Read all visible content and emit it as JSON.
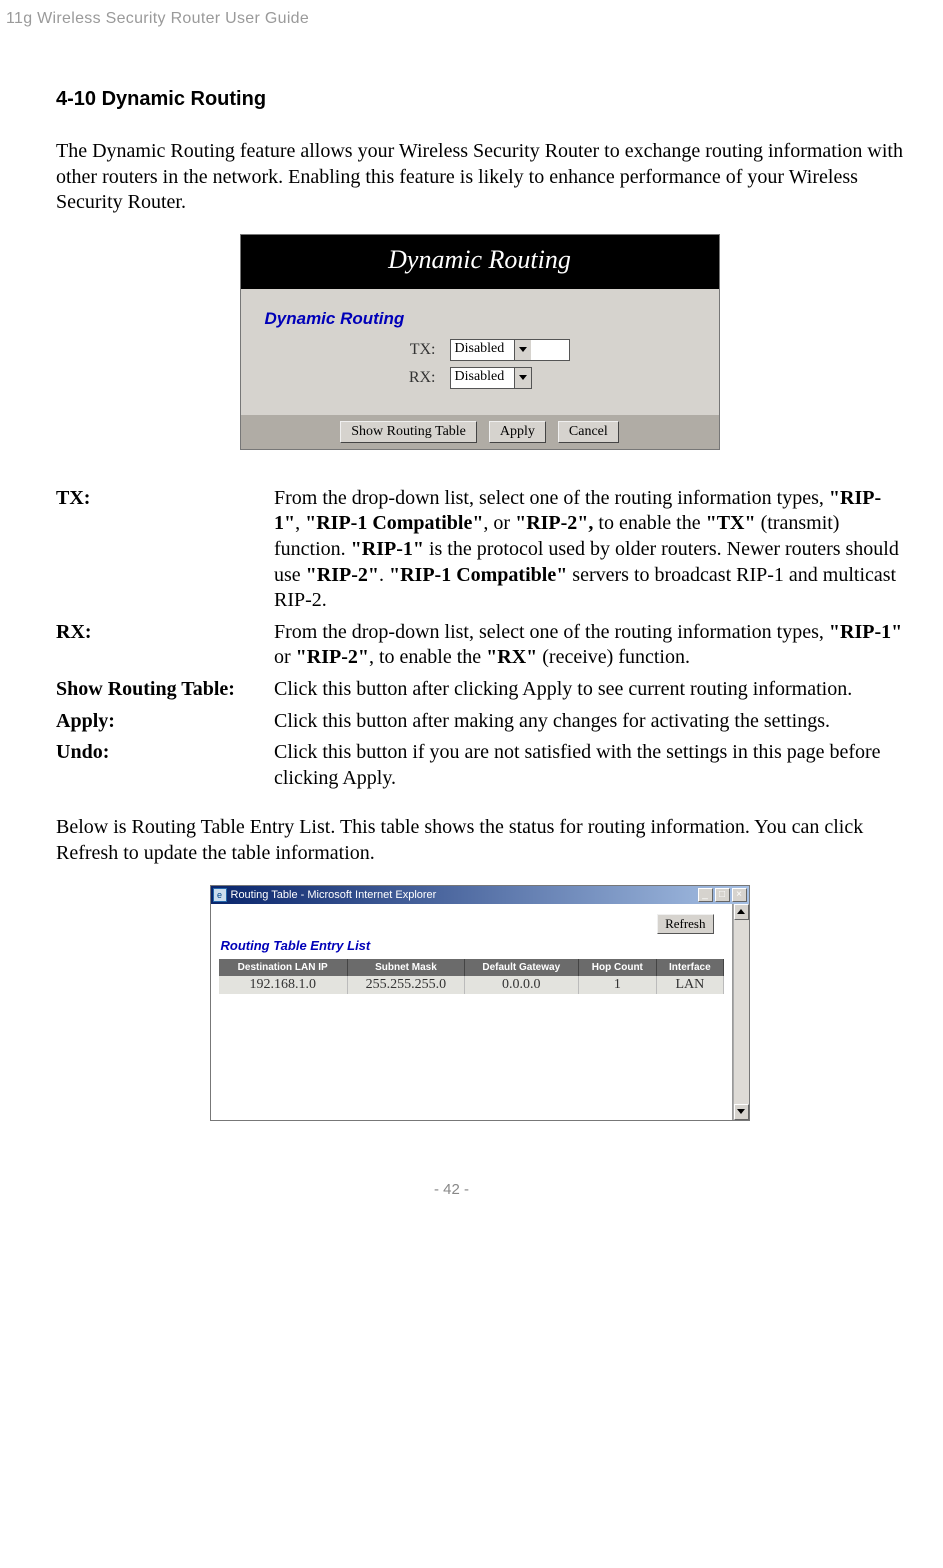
{
  "header": "11g Wireless Security Router User Guide",
  "section_title": "4-10 Dynamic Routing",
  "intro": "The Dynamic Routing feature allows your Wireless Security Router to exchange routing information with other routers in the network. Enabling this feature is likely to enhance performance of your Wireless Security Router.",
  "fig1": {
    "title": "Dynamic Routing",
    "subtitle": "Dynamic Routing",
    "tx_label": "TX:",
    "rx_label": "RX:",
    "tx_value": "Disabled",
    "rx_value": "Disabled",
    "btn_show": "Show Routing Table",
    "btn_apply": "Apply",
    "btn_cancel": "Cancel"
  },
  "defs": {
    "tx": {
      "term": "TX:",
      "p1": "From the drop-down list, select one of the routing information types, ",
      "b1": "\"RIP-1\"",
      "p2": ", ",
      "b2": "\"RIP-1 Compatible\"",
      "p3": ", or ",
      "b3": "\"RIP-2\",",
      "p4": " to enable the ",
      "b4": "\"TX\"",
      "p5": " (transmit) function. ",
      "b5": "\"RIP-1\"",
      "p6": " is the protocol used by older routers. Newer routers should use ",
      "b6": "\"RIP-2\"",
      "p7": ". ",
      "b7": "\"RIP-1 Compatible\"",
      "p8": " servers to broadcast RIP-1 and multicast RIP-2."
    },
    "rx": {
      "term": "RX:",
      "p1": "From the drop-down list, select one of the routing information types, ",
      "b1": "\"RIP-1\"",
      "p2": " or ",
      "b2": "\"RIP-2\"",
      "p3": ", to enable the ",
      "b3": "\"RX\"",
      "p4": " (receive) function."
    },
    "show": {
      "term": "Show Routing Table:",
      "desc": "Click this button after clicking Apply to see current routing information."
    },
    "apply": {
      "term": "Apply:",
      "desc": "Click this button after making any changes for activating the settings."
    },
    "undo": {
      "term": "Undo:",
      "desc": "Click this button if you are not satisfied with the settings in this page before clicking Apply."
    }
  },
  "below_para": "Below is Routing Table Entry List. This table shows the status for routing information. You can click Refresh to update the table information.",
  "fig2": {
    "window_title": "Routing Table - Microsoft Internet Explorer",
    "refresh": "Refresh",
    "list_title": "Routing Table Entry List",
    "headers": [
      "Destination LAN IP",
      "Subnet Mask",
      "Default Gateway",
      "Hop Count",
      "Interface"
    ],
    "row": [
      "192.168.1.0",
      "255.255.255.0",
      "0.0.0.0",
      "1",
      "LAN"
    ]
  },
  "footer": "- 42 -",
  "chart_data": {
    "type": "table",
    "title": "Routing Table Entry List",
    "columns": [
      "Destination LAN IP",
      "Subnet Mask",
      "Default Gateway",
      "Hop Count",
      "Interface"
    ],
    "rows": [
      [
        "192.168.1.0",
        "255.255.255.0",
        "0.0.0.0",
        1,
        "LAN"
      ]
    ]
  }
}
